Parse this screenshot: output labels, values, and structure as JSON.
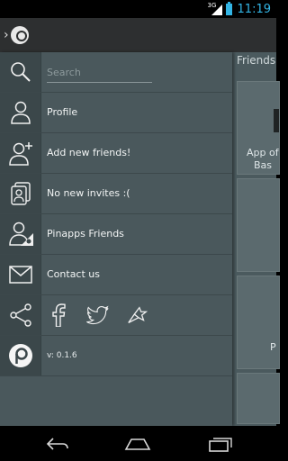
{
  "status_bar": {
    "network_type": "3G",
    "time": "11:19",
    "accent_color": "#33b5e5"
  },
  "action_bar": {
    "up_icon": "chevron-left-icon",
    "app_icon": "pinapps-logo-icon"
  },
  "background": {
    "header": "Friends",
    "cards": [
      {
        "text_line1": "App of",
        "text_line2": "Bas"
      },
      {
        "text_line1": "",
        "text_line2": ""
      },
      {
        "text_line1": "P",
        "text_line2": ""
      },
      {
        "text_line1": "",
        "text_line2": ""
      }
    ]
  },
  "drawer": {
    "search": {
      "placeholder": "Search",
      "value": "",
      "icon": "search-icon"
    },
    "items": [
      {
        "label": "Profile",
        "icon": "person-icon"
      },
      {
        "label": "Add new friends!",
        "icon": "person-add-icon"
      },
      {
        "label": "No new invites :(",
        "icon": "contacts-cards-icon"
      },
      {
        "label": "Pinapps Friends",
        "icon": "pinapps-friends-icon"
      },
      {
        "label": "Contact us",
        "icon": "envelope-icon"
      }
    ],
    "share": {
      "icon": "share-icon",
      "links": [
        "facebook-icon",
        "twitter-icon",
        "pinapps-bird-icon"
      ]
    },
    "about": {
      "icon": "pinapps-logo-icon",
      "version": "v: 0.1.6"
    }
  },
  "nav_bar": {
    "buttons": [
      "back-icon",
      "home-icon",
      "recent-apps-icon"
    ]
  }
}
